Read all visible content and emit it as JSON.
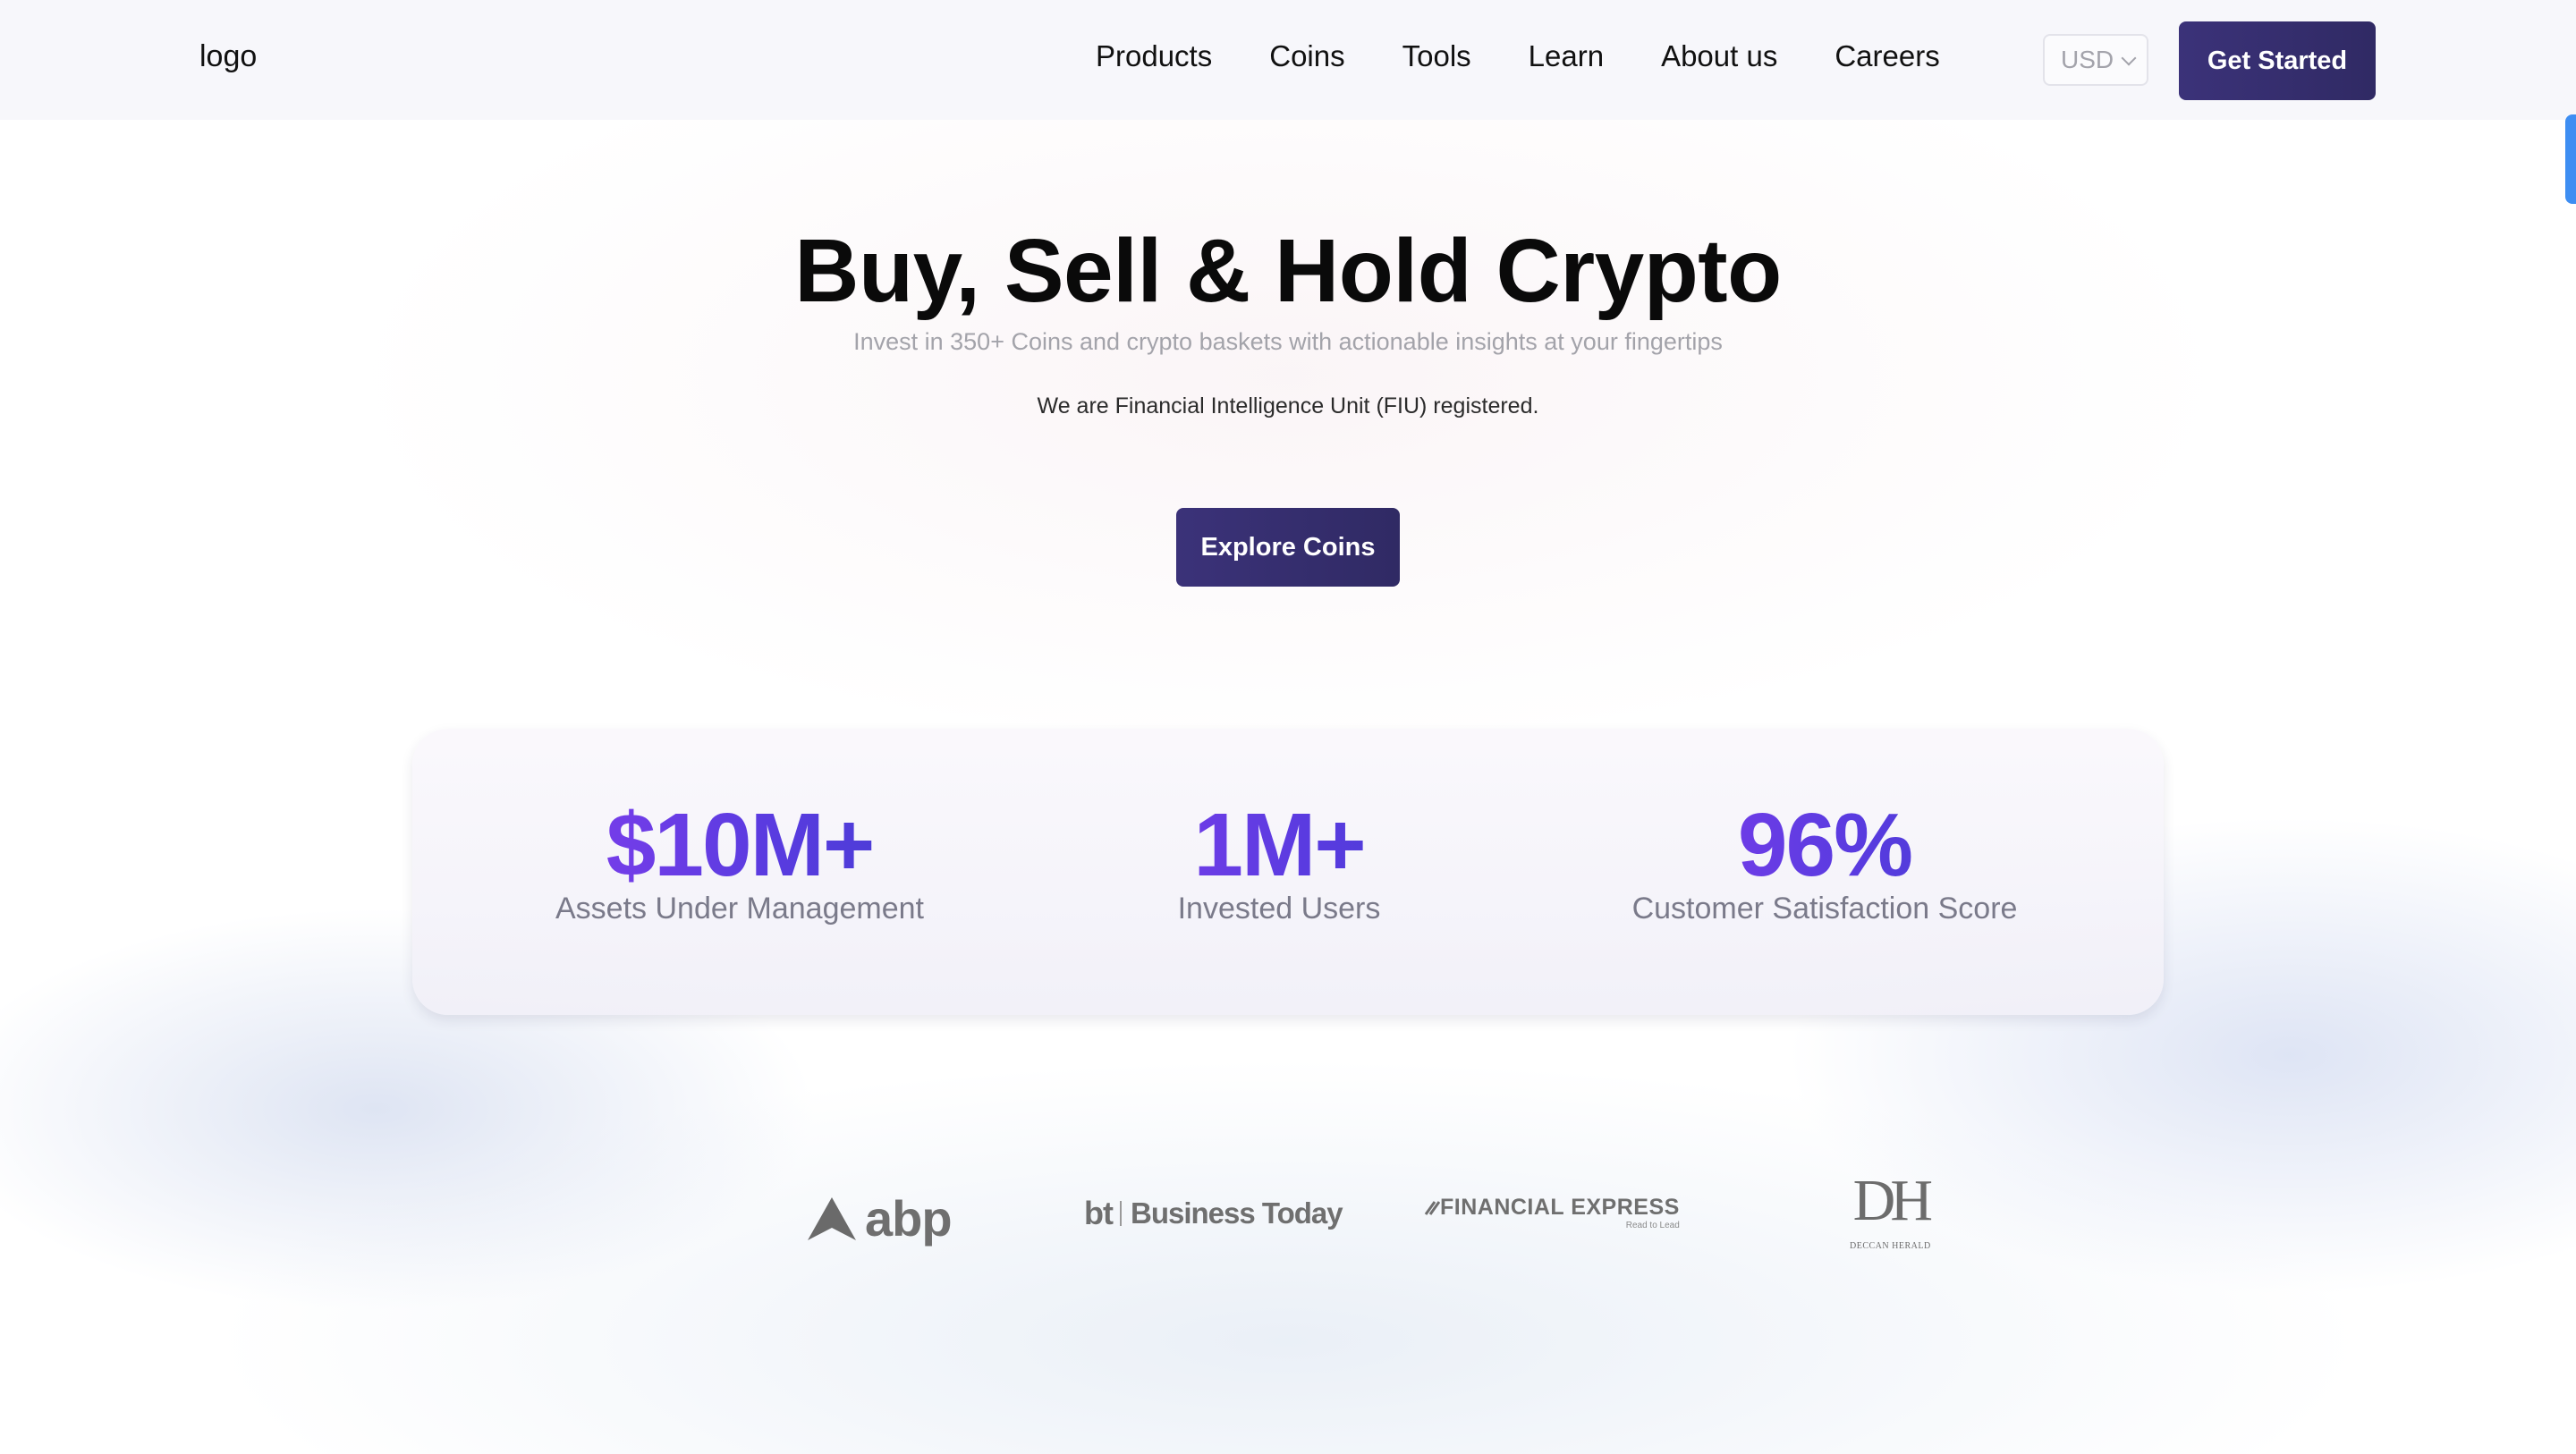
{
  "nav": {
    "logo": "logo",
    "links": [
      "Products",
      "Coins",
      "Tools",
      "Learn",
      "About us",
      "Careers"
    ],
    "currency": "USD",
    "cta": "Get Started"
  },
  "hero": {
    "title": "Buy, Sell & Hold Crypto",
    "subtitle": "Invest in 350+ Coins and crypto baskets with actionable insights at your fingertips",
    "note": "We are Financial Intelligence Unit (FIU) registered.",
    "cta": "Explore Coins"
  },
  "stats": [
    {
      "value": "$10M+",
      "label": "Assets Under Management"
    },
    {
      "value": "1M+",
      "label": "Invested Users"
    },
    {
      "value": "96%",
      "label": "Customer Satisfaction Score"
    }
  ],
  "press": {
    "abp": "abp",
    "bt_mark": "bt",
    "bt_name": "Business Today",
    "fe_name": "FINANCIAL EXPRESS",
    "fe_tag": "Read to Lead",
    "dh_mark": "DH",
    "dh_name": "DECCAN HERALD"
  },
  "colors": {
    "primary_button": "#352d6e",
    "stat_gradient_start": "#8a3ff0",
    "stat_gradient_end": "#3f3dce",
    "scroll_accent": "#3e8ef2"
  }
}
